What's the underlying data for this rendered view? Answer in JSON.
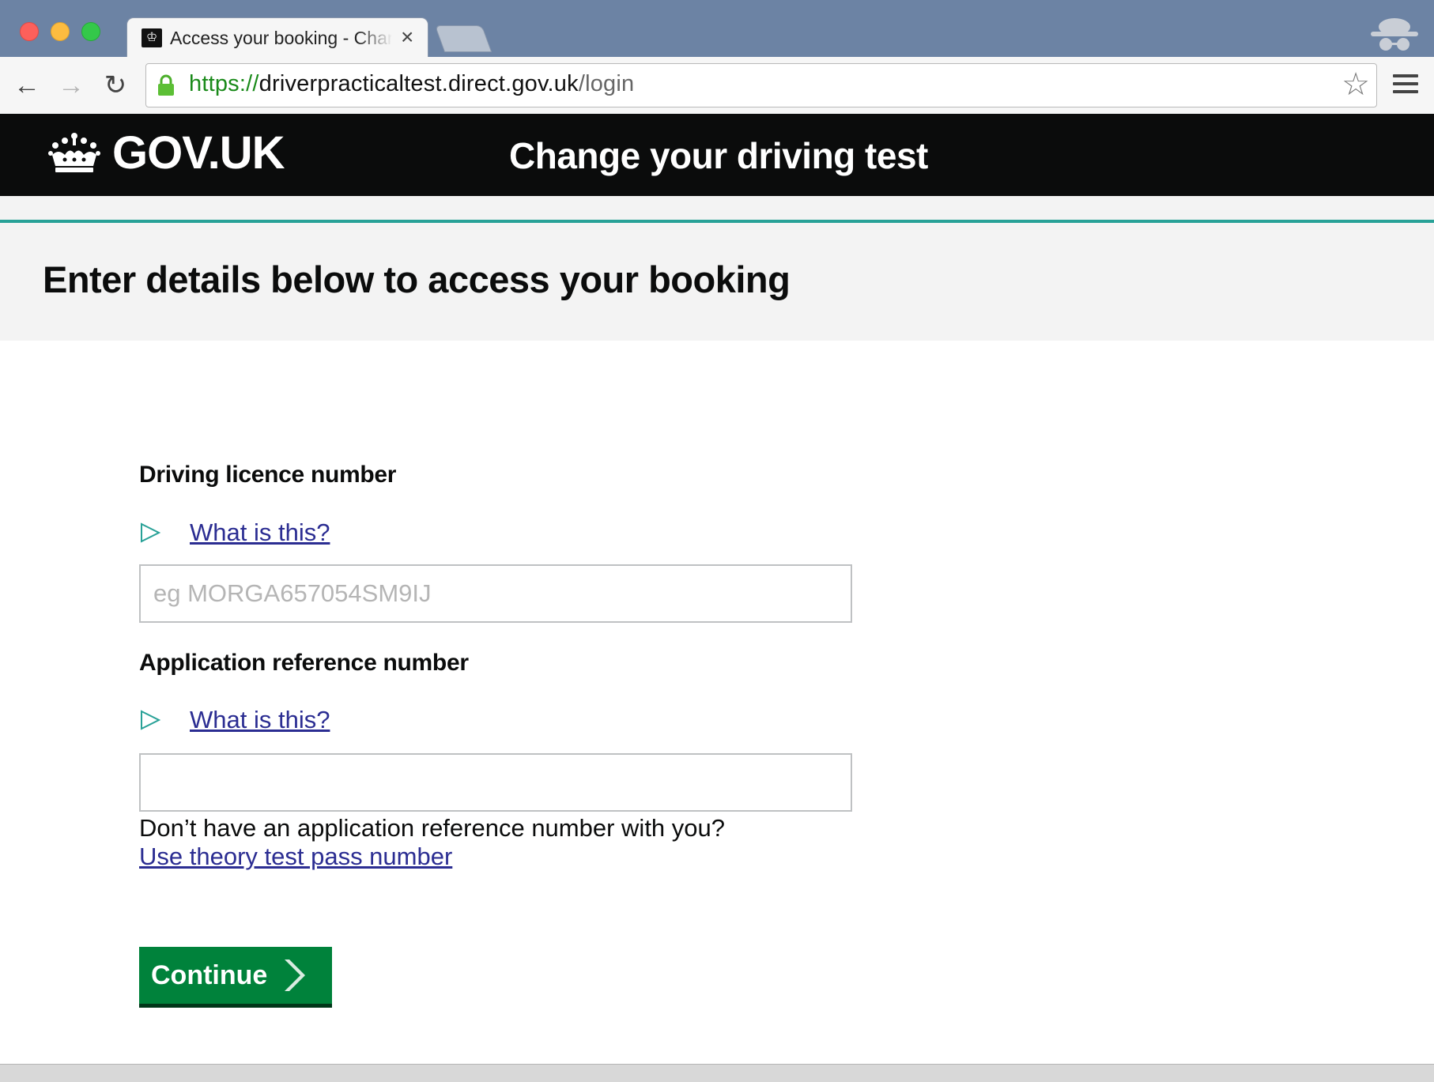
{
  "browser": {
    "tab_title": "Access your booking - Change your driving test",
    "tab_favicon": "♔",
    "tab_close": "×",
    "url": {
      "scheme": "https://",
      "host": "driverpracticaltest.direct.gov.uk",
      "path": "/login"
    },
    "icons": {
      "back": "←",
      "forward": "→",
      "reload": "↻",
      "bookmark": "☆"
    }
  },
  "header": {
    "logo_text": "GOV.UK",
    "service_name": "Change your driving test"
  },
  "page": {
    "title": "Enter details below to access your booking"
  },
  "form": {
    "licence": {
      "label": "Driving licence number",
      "help_link": "What is this?",
      "placeholder": "eg MORGA657054SM9IJ",
      "value": ""
    },
    "reference": {
      "label": "Application reference number",
      "help_link": "What is this?",
      "value": ""
    },
    "hint": "Don’t have an application reference number with you?",
    "alt_link": "Use theory test pass number",
    "submit_label": "Continue"
  },
  "colors": {
    "header_bg": "#0b0c0c",
    "accent_teal": "#28a197",
    "link": "#2b2d92",
    "button": "#00823b"
  }
}
